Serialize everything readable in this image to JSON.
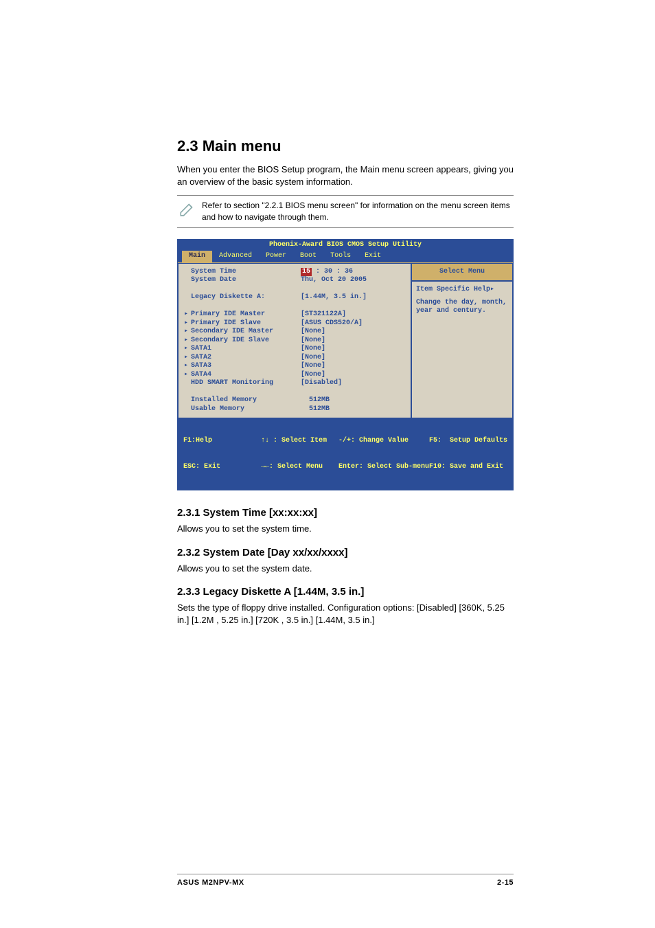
{
  "headings": {
    "main": "2.3    Main menu",
    "system_time": "2.3.1   System Time [xx:xx:xx]",
    "system_date": "2.3.2   System Date [Day xx/xx/xxxx]",
    "legacy": "2.3.3   Legacy Diskette A [1.44M, 3.5 in.]"
  },
  "intro": "When you enter the BIOS Setup program, the Main menu screen appears, giving you an overview of the basic system information.",
  "note": "Refer to section \"2.2.1  BIOS menu screen\" for information on the menu screen items and how to navigate through them.",
  "section_system_time": "Allows you to set the system time.",
  "section_system_date": "Allows you to set the system date.",
  "section_legacy": "Sets the type of floppy drive installed. Configuration options: [Disabled] [360K, 5.25 in.] [1.2M , 5.25 in.] [720K , 3.5 in.] [1.44M, 3.5 in.]",
  "footer_left": "ASUS M2NPV-MX",
  "footer_right": "2-15",
  "bios": {
    "title": "Phoenix-Award BIOS CMOS Setup Utility",
    "tabs": [
      "Main",
      "Advanced",
      "Power",
      "Boot",
      "Tools",
      "Exit"
    ],
    "select_menu": "Select Menu",
    "help_line1": "Item Specific Help▸",
    "help_line2": "Change the day, month, year and century.",
    "rows": {
      "system_time": {
        "label": "System Time",
        "hl": "15",
        "rest": " : 30 : 36"
      },
      "system_date": {
        "label": "System Date",
        "val": "Thu, Oct 20 2005"
      },
      "legacy": {
        "label": "Legacy Diskette A:",
        "val": "[1.44M, 3.5 in.]"
      },
      "p_ide_m": {
        "label": "Primary IDE Master",
        "val": "[ST321122A]"
      },
      "p_ide_s": {
        "label": "Primary IDE Slave",
        "val": "[ASUS CDS520/A]"
      },
      "s_ide_m": {
        "label": "Secondary IDE Master",
        "val": "[None]"
      },
      "s_ide_s": {
        "label": "Secondary IDE Slave",
        "val": "[None]"
      },
      "sata1": {
        "label": "SATA1",
        "val": "[None]"
      },
      "sata2": {
        "label": "SATA2",
        "val": "[None]"
      },
      "sata3": {
        "label": "SATA3",
        "val": "[None]"
      },
      "sata4": {
        "label": "SATA4",
        "val": "[None]"
      },
      "hdd": {
        "label": "HDD SMART Monitoring",
        "val": "[Disabled]"
      },
      "imem": {
        "label": "Installed Memory",
        "val": "  512MB"
      },
      "umem": {
        "label": "Usable Memory",
        "val": "  512MB"
      }
    },
    "legend": {
      "c1a": "F1:Help",
      "c1b": "ESC: Exit",
      "c2a": "↑↓ : Select Item",
      "c2b": "→←: Select Menu",
      "c3a": "-/+: Change Value",
      "c3b": "Enter: Select Sub-menu",
      "c4a": "F5:  Setup Defaults",
      "c4b": "F10: Save and Exit"
    }
  }
}
